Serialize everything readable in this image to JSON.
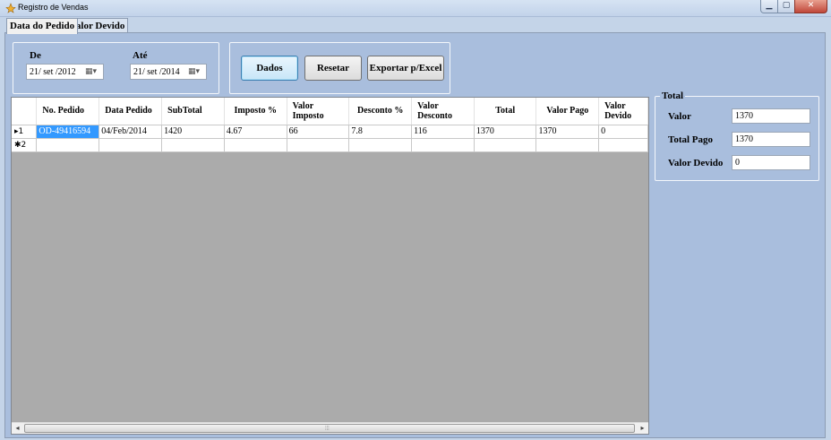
{
  "window": {
    "title": "Registro de Vendas",
    "min_glyph": "▁",
    "max_glyph": "▢",
    "close_glyph": "✕"
  },
  "tabs": [
    {
      "label": "Data do Pedido",
      "active": true
    },
    {
      "label": "Valor Devido",
      "active": false
    }
  ],
  "filters": {
    "from_label": "De",
    "from_value": "21/ set /2012",
    "to_label": "Até",
    "to_value": "21/ set /2014",
    "calendar_glyph": "▦▾"
  },
  "actions": {
    "data_label": "Dados",
    "reset_label": "Resetar",
    "export_label": "Exportar p/Excel"
  },
  "grid": {
    "columns": [
      "No. Pedido",
      "Data Pedido",
      "SubTotal",
      "Imposto %",
      "Valor\nImposto",
      "Desconto %",
      "Valor\nDesconto",
      "Total",
      "Valor Pago",
      "Valor\nDevido"
    ],
    "rows": [
      {
        "header": "▸1",
        "cells": [
          "OD-49416594",
          "04/Feb/2014",
          "1420",
          "4.67",
          "66",
          "7.8",
          "116",
          "1370",
          "1370",
          "0"
        ]
      },
      {
        "header": "✱2",
        "cells": [
          "",
          "",
          "",
          "",
          "",
          "",
          "",
          "",
          "",
          ""
        ]
      }
    ],
    "scroll_left": "◂",
    "scroll_right": "▸",
    "scroll_grip": "⦙⦙⦙"
  },
  "totals": {
    "legend": "Total",
    "valor_label": "Valor",
    "valor_value": "1370",
    "pago_label": "Total Pago",
    "pago_value": "1370",
    "devido_label": "Valor Devido",
    "devido_value": "0"
  },
  "colors": {
    "panel_bg": "#a9bedd",
    "selection": "#3399ff",
    "grid_empty": "#ababab"
  }
}
